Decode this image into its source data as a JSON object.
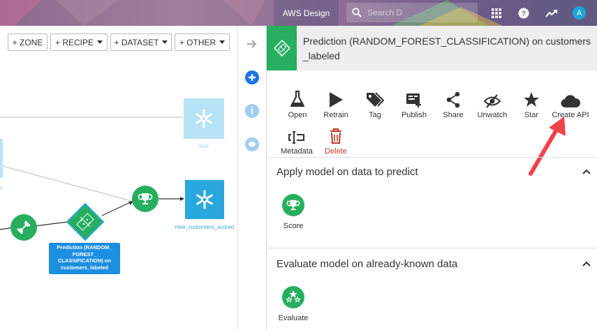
{
  "topbar": {
    "project_name": "AWS Design",
    "search_placeholder": "Search D",
    "avatar_initial": "A"
  },
  "flow_toolbar": {
    "zone": "+ ZONE",
    "recipe": "+ RECIPE",
    "dataset": "+ DATASET",
    "other": "+ OTHER"
  },
  "flow": {
    "nodes": {
      "test": "test",
      "new_customers_scored": "new_customers_scored",
      "model_line1": "Prediction (RANDOM_",
      "model_line2": "FOREST_",
      "model_line3": "CLASSIFICATION) on",
      "model_line4": "customers_labeled",
      "partial_left": "_"
    }
  },
  "panel": {
    "title": "Prediction (RANDOM_FOREST_CLASSIFICATION) on customers_labeled",
    "actions": {
      "open": "Open",
      "retrain": "Retrain",
      "tag": "Tag",
      "publish": "Publish",
      "share": "Share",
      "unwatch": "Unwatch",
      "star": "Star",
      "create_api": "Create API",
      "metadata": "Metadata",
      "delete": "Delete"
    },
    "sections": {
      "apply": {
        "title": "Apply model on data to predict",
        "score": "Score"
      },
      "evaluate": {
        "title": "Evaluate model on already-known data",
        "evaluate": "Evaluate"
      }
    }
  },
  "colors": {
    "green": "#27ae60",
    "blue": "#29a8dd",
    "danger": "#c0392b",
    "arrow": "#f0424a"
  }
}
